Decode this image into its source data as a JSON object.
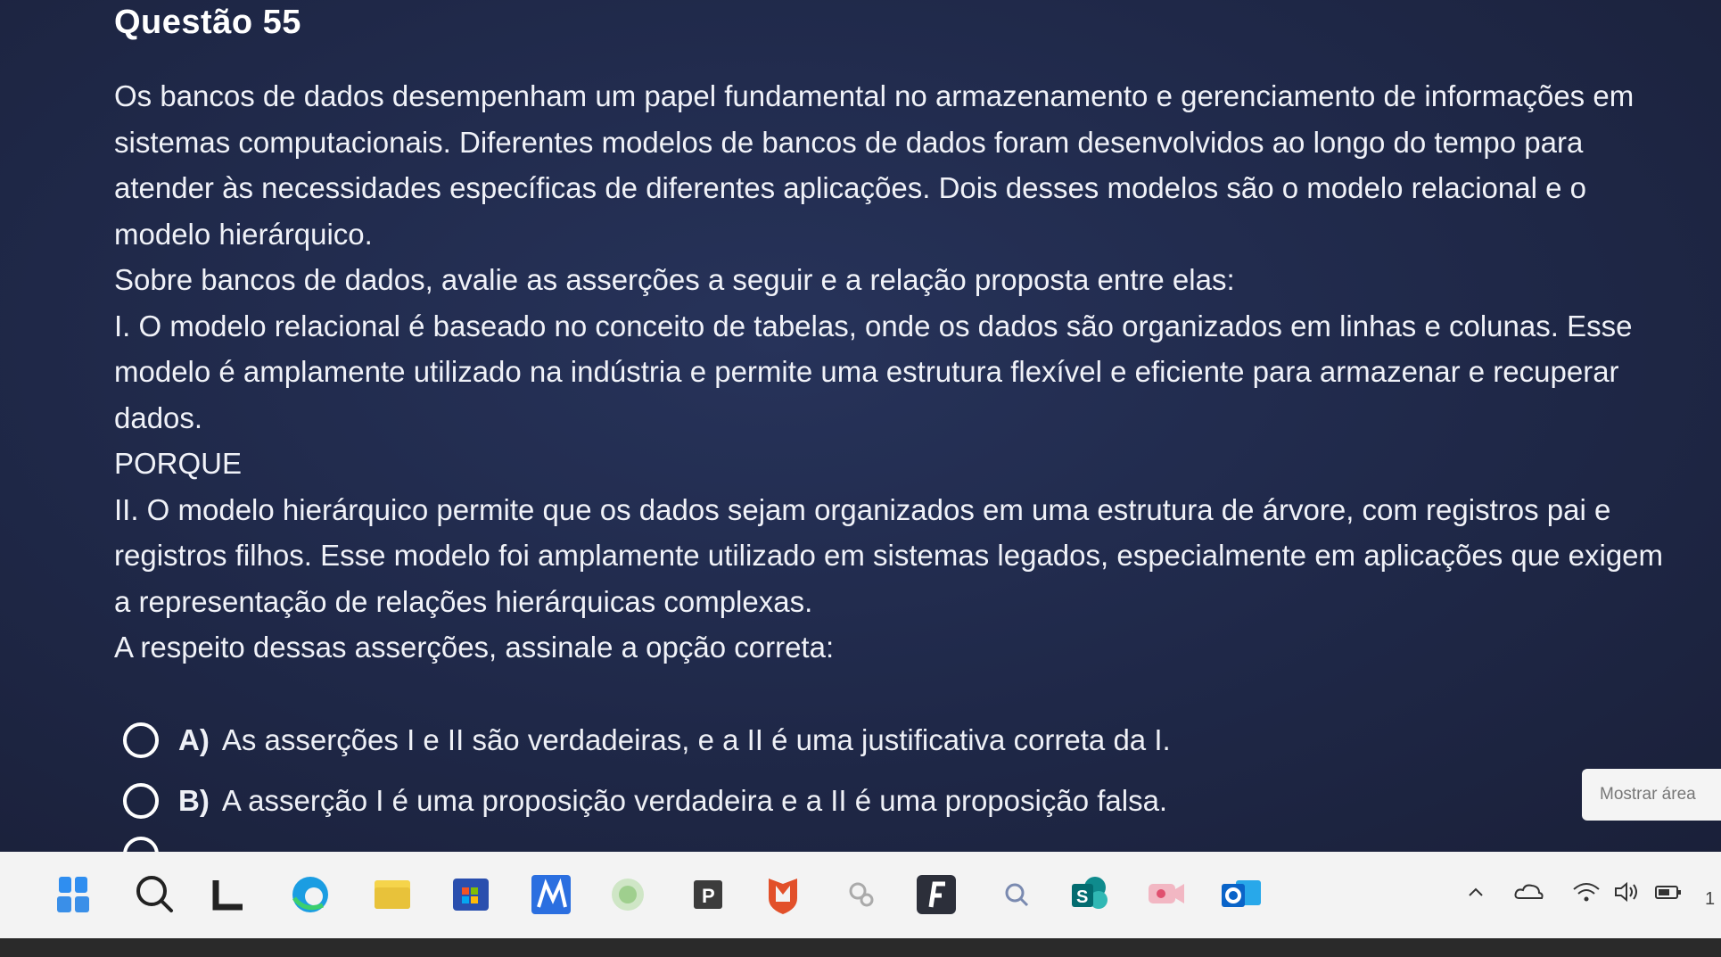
{
  "question": {
    "title": "Questão 55",
    "paragraphs": [
      "Os bancos de dados desempenham um papel fundamental no armazenamento e gerenciamento de informações em sistemas computacionais. Diferentes modelos de bancos de dados foram desenvolvidos ao longo do tempo para atender às necessidades específicas de diferentes aplicações. Dois desses modelos são o modelo relacional e o modelo hierárquico.",
      "Sobre bancos de dados, avalie as asserções a seguir e a relação proposta entre elas:",
      "I. O modelo relacional é baseado no conceito de tabelas, onde os dados são organizados em linhas e colunas. Esse modelo é amplamente utilizado na indústria e permite uma estrutura flexível e eficiente para armazenar e recuperar dados.",
      "PORQUE",
      "II. O modelo hierárquico permite que os dados sejam organizados em uma estrutura de árvore, com registros pai e registros filhos. Esse modelo foi amplamente utilizado em sistemas legados, especialmente em aplicações que exigem a representação de relações hierárquicas complexas.",
      "A respeito dessas asserções, assinale a opção correta:"
    ]
  },
  "options": [
    {
      "letter": "A)",
      "text": "As asserções I e II são verdadeiras, e a II é uma justificativa correta da I."
    },
    {
      "letter": "B)",
      "text": "A asserção I é uma proposição verdadeira e a II é uma proposição falsa."
    }
  ],
  "show_area_button": "Mostrar área",
  "taskbar": {
    "icons": [
      "widgets-icon",
      "search-icon",
      "letter-l-icon",
      "edge-icon",
      "file-explorer-icon",
      "store-icon",
      "app-m-icon",
      "app-green-icon",
      "app-p-icon",
      "shield-app-icon",
      "app-gray-icon",
      "app-f-icon",
      "search-small-icon",
      "sharepoint-icon",
      "camera-app-icon",
      "outlook-icon"
    ],
    "tray_icons": [
      "chevron-up-icon",
      "cloud-icon",
      "wifi-icon",
      "volume-icon",
      "battery-icon"
    ],
    "clock_fragment": "1"
  }
}
